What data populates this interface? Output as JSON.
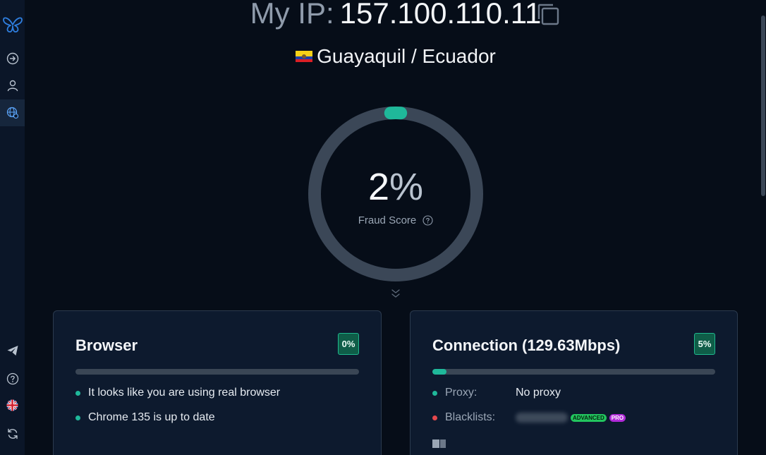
{
  "header": {
    "ip_label": "My IP:",
    "ip_value": "157.100.110.11",
    "location": "Guayaquil / Ecuador"
  },
  "score": {
    "value": "2",
    "unit": "%",
    "label": "Fraud Score",
    "fraction": 0.02
  },
  "browser_card": {
    "title": "Browser",
    "badge": "0%",
    "bar_fraction": 0.0,
    "items": [
      "It looks like you are using real browser",
      "Chrome 135 is up to date"
    ]
  },
  "connection_card": {
    "title": "Connection",
    "speed": "(129.63Mbps)",
    "badge": "5%",
    "bar_fraction": 0.05,
    "proxy_label": "Proxy:",
    "proxy_value": "No proxy",
    "blacklists_label": "Blacklists:",
    "tag_advanced": "ADVANCED",
    "tag_pro": "PRO"
  },
  "colors": {
    "accent": "#1fb89a",
    "background": "#060d18",
    "card": "#0d1a2e",
    "danger": "#e5484d"
  },
  "icons": {
    "sidebar": [
      "butterfly-logo-icon",
      "arrow-right-circle-icon",
      "user-icon",
      "globe-icon",
      "telegram-icon",
      "help-icon",
      "uk-flag-icon",
      "refresh-icon"
    ]
  }
}
